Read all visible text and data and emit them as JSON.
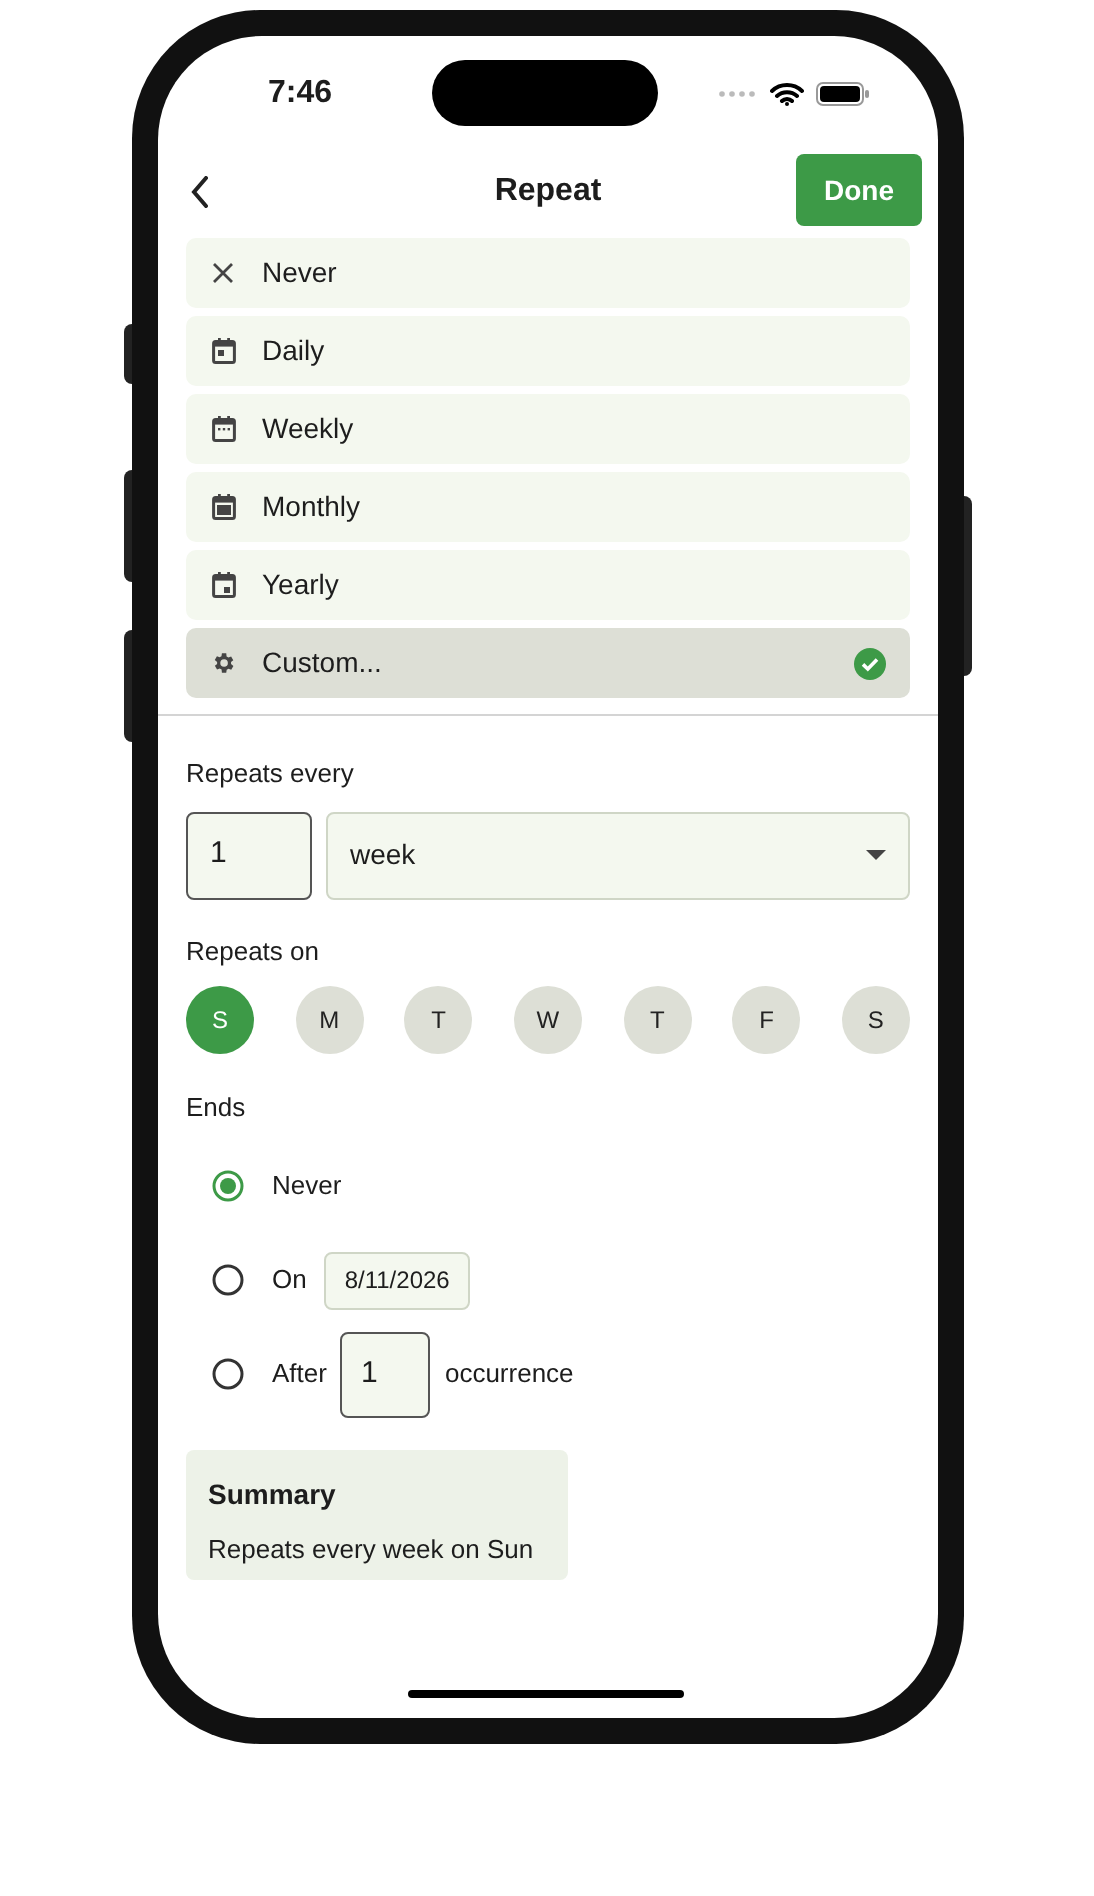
{
  "status_bar": {
    "time": "7:46"
  },
  "header": {
    "title": "Repeat",
    "done": "Done"
  },
  "options": [
    {
      "kind": "never",
      "label": "Never",
      "selected": false
    },
    {
      "kind": "daily",
      "label": "Daily",
      "selected": false
    },
    {
      "kind": "weekly",
      "label": "Weekly",
      "selected": false
    },
    {
      "kind": "monthly",
      "label": "Monthly",
      "selected": false
    },
    {
      "kind": "yearly",
      "label": "Yearly",
      "selected": false
    },
    {
      "kind": "custom",
      "label": "Custom...",
      "selected": true
    }
  ],
  "repeats_every": {
    "label": "Repeats every",
    "count": "1",
    "unit": "week"
  },
  "repeats_on": {
    "label": "Repeats on",
    "days": [
      {
        "label": "S",
        "selected": true
      },
      {
        "label": "M",
        "selected": false
      },
      {
        "label": "T",
        "selected": false
      },
      {
        "label": "W",
        "selected": false
      },
      {
        "label": "T",
        "selected": false
      },
      {
        "label": "F",
        "selected": false
      },
      {
        "label": "S",
        "selected": false
      }
    ]
  },
  "ends": {
    "label": "Ends",
    "options": [
      {
        "kind": "never",
        "label": "Never",
        "selected": true
      },
      {
        "kind": "on",
        "label": "On",
        "date": "8/11/2026",
        "selected": false
      },
      {
        "kind": "after",
        "label": "After",
        "count": "1",
        "suffix": "occurrence",
        "selected": false
      }
    ]
  },
  "summary": {
    "title": "Summary",
    "text": "Repeats every week on Sun"
  }
}
